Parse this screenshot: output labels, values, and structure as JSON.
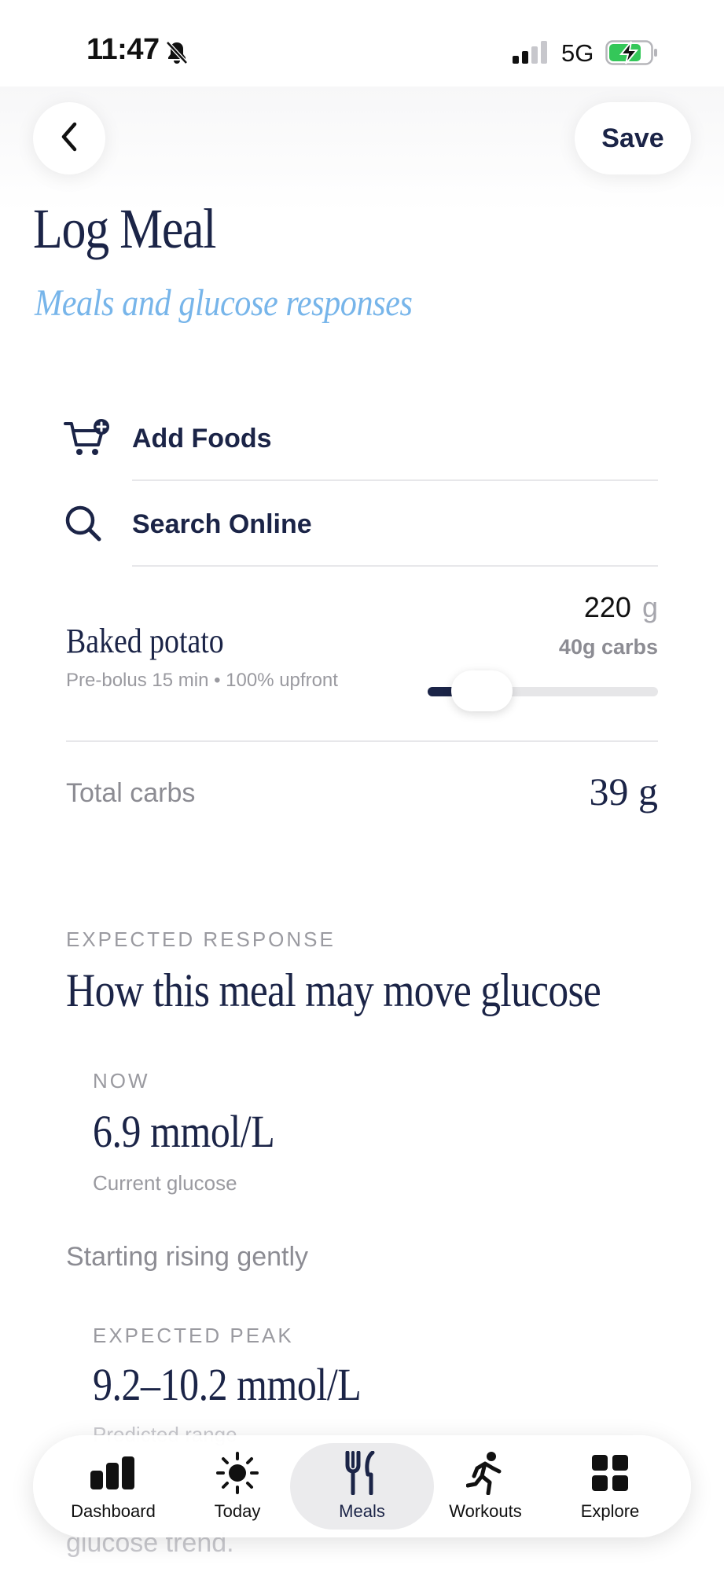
{
  "status_bar": {
    "time": "11:47",
    "network": "5G",
    "icons": [
      "bell-slash-icon",
      "signal-icon",
      "battery-charging-icon"
    ]
  },
  "header": {
    "back_icon": "chevron-left-icon",
    "save_label": "Save",
    "title": "Log Meal",
    "subtitle": "Meals and glucose responses"
  },
  "actions": [
    {
      "label": "Add Foods",
      "icon": "cart-plus-icon"
    },
    {
      "label": "Search Online",
      "icon": "search-icon"
    }
  ],
  "food_item": {
    "name": "Baked potato",
    "meta": "Pre-bolus 15 min • 100% upfront",
    "quantity": "220",
    "unit": "g",
    "carbs": "40g carbs",
    "slider_fraction": 0.2
  },
  "totals": {
    "label": "Total carbs",
    "value": "39 g"
  },
  "expected_response": {
    "kicker": "EXPECTED RESPONSE",
    "heading": "How this meal may move glucose",
    "now": {
      "kicker": "NOW",
      "value": "6.9 mmol/L",
      "caption": "Current glucose"
    },
    "status": "Starting rising gently",
    "peak": {
      "kicker": "EXPECTED PEAK",
      "value": "9.2–10.2 mmol/L",
      "caption": "Predicted range"
    },
    "trailing_text": "glucose trend."
  },
  "tabs": [
    {
      "label": "Dashboard",
      "icon": "bar-chart-icon",
      "active": false
    },
    {
      "label": "Today",
      "icon": "sun-icon",
      "active": false
    },
    {
      "label": "Meals",
      "icon": "fork-knife-icon",
      "active": true
    },
    {
      "label": "Workouts",
      "icon": "running-icon",
      "active": false
    },
    {
      "label": "Explore",
      "icon": "grid-icon",
      "active": false
    }
  ],
  "colors": {
    "navy": "#1b2447",
    "subtitle_blue": "#77b5ea",
    "muted_gray": "#8c8c93",
    "battery_green": "#34c759"
  }
}
